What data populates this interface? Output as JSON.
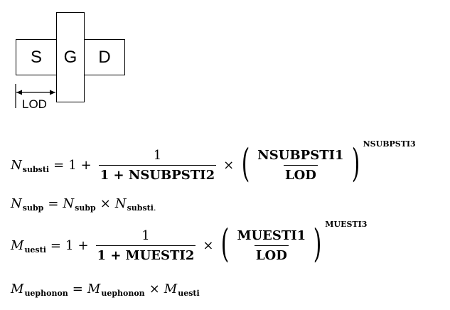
{
  "diagram": {
    "source_label": "S",
    "gate_label": "G",
    "drain_label": "D",
    "lod_label": "LOD"
  },
  "equations": {
    "eq1": {
      "lhs_var": "N",
      "lhs_sub": "substi",
      "equals": "=",
      "one": "1",
      "plus": "+",
      "frac1_num": "1",
      "frac1_den": "1 + NSUBPSTI2",
      "times": "×",
      "frac2_num": "NSUBPSTI1",
      "frac2_den": "LOD",
      "exponent": "NSUBPSTI3"
    },
    "eq2": {
      "lhs_var": "N",
      "lhs_sub": "subp",
      "equals": "=",
      "rhs1_var": "N",
      "rhs1_sub": "subp",
      "times": "×",
      "rhs2_var": "N",
      "rhs2_sub": "substi",
      "trailing": "."
    },
    "eq3": {
      "lhs_var": "M",
      "lhs_sub": "uesti",
      "equals": "=",
      "one": "1",
      "plus": "+",
      "frac1_num": "1",
      "frac1_den": "1 + MUESTI2",
      "times": "×",
      "frac2_num": "MUESTI1",
      "frac2_den": "LOD",
      "exponent": "MUESTI3"
    },
    "eq4": {
      "lhs_var": "M",
      "lhs_sub": "uephonon",
      "equals": "=",
      "rhs1_var": "M",
      "rhs1_sub": "uephonon",
      "times": "×",
      "rhs2_var": "M",
      "rhs2_sub": "uesti"
    }
  }
}
